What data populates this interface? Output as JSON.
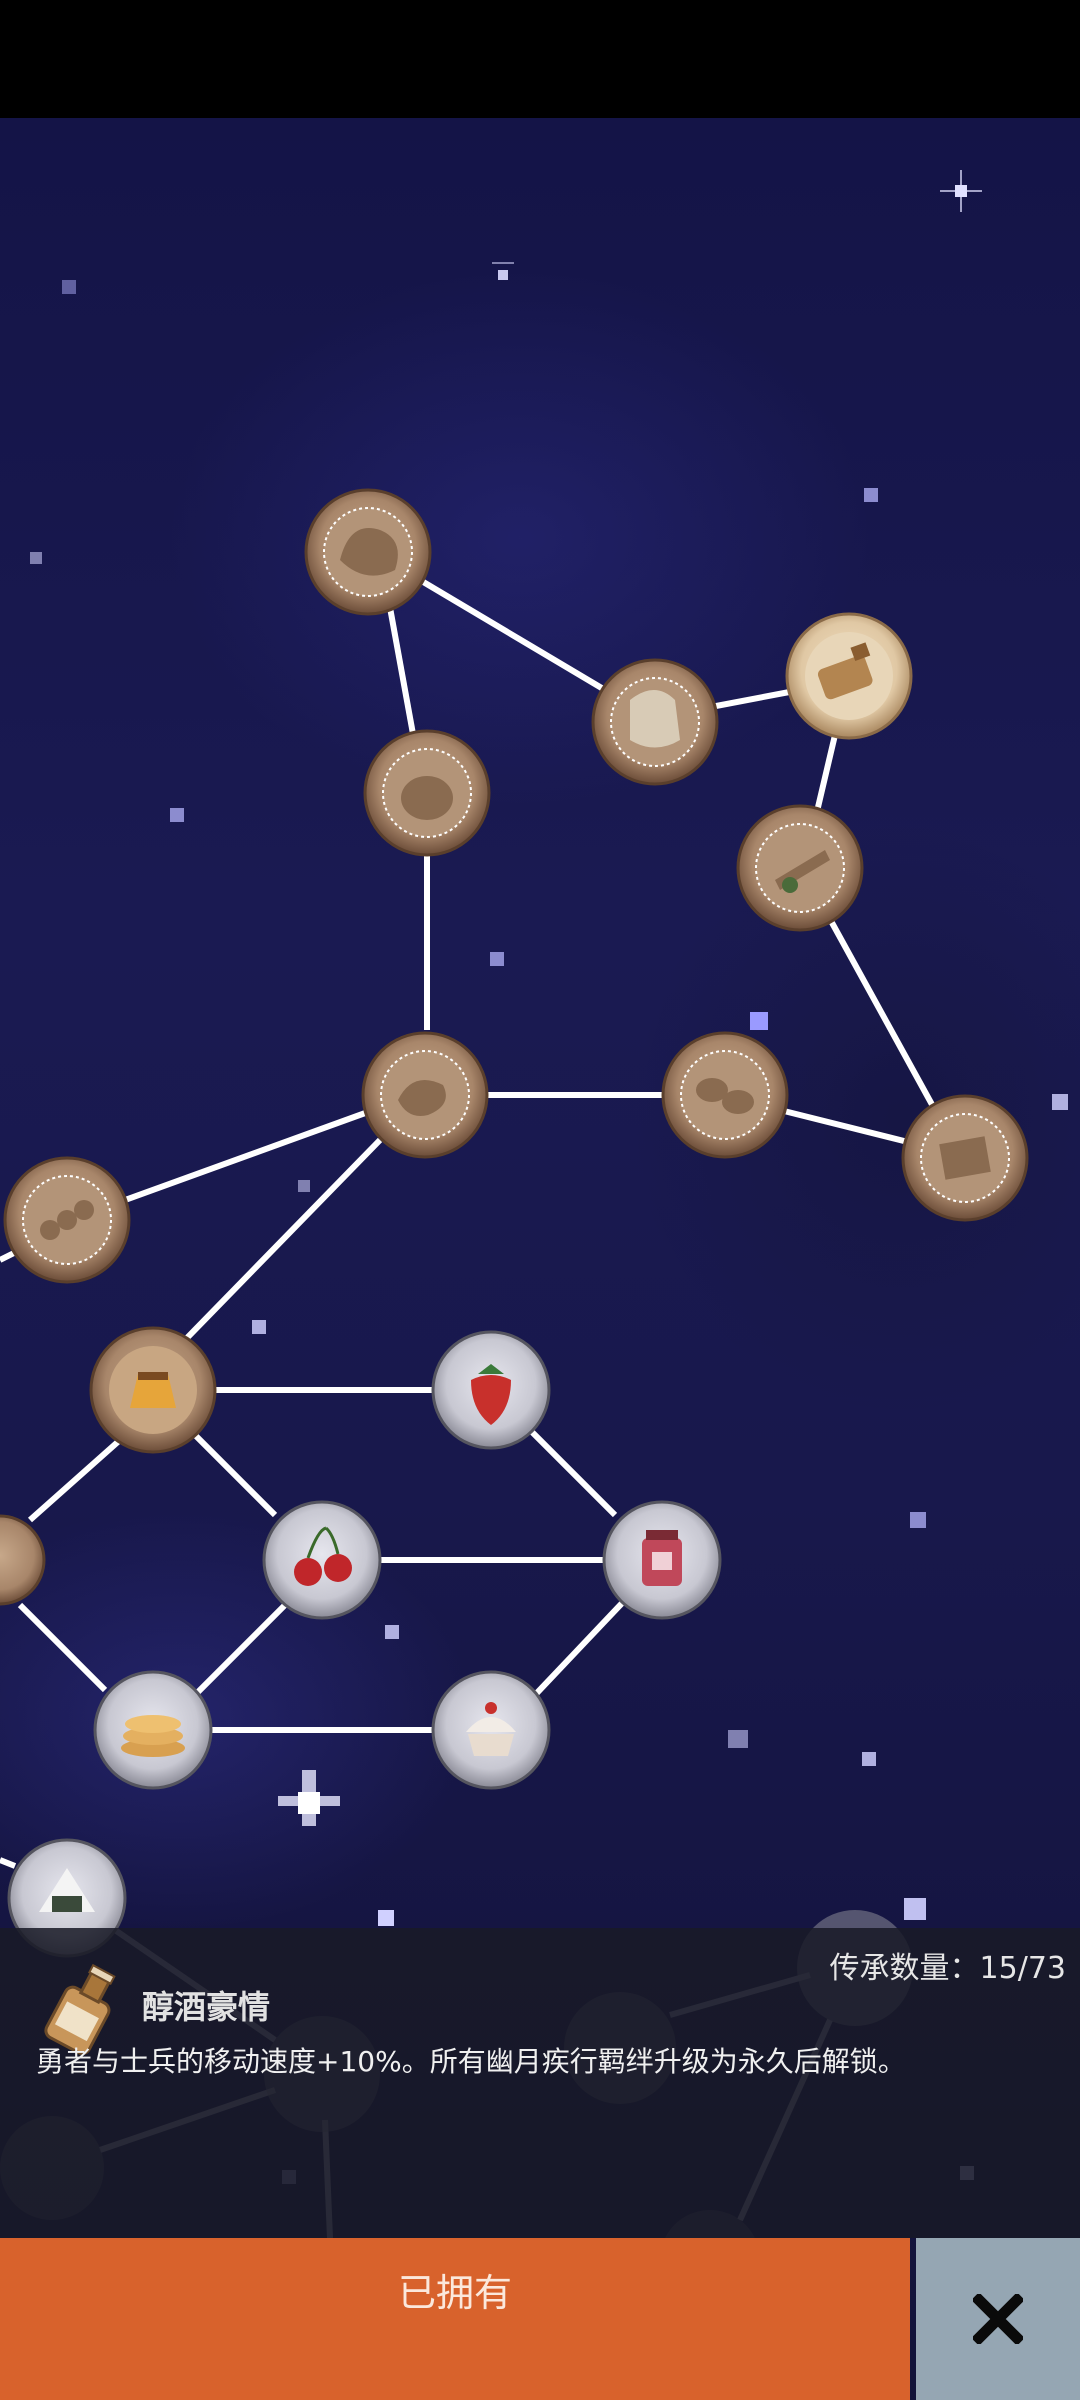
{
  "legacy": {
    "label": "传承数量：",
    "current": "15/73"
  },
  "selected_item": {
    "name": "醇酒豪情",
    "description": "勇者与士兵的移动速度+10%。所有幽月疾行羁绊升级为永久后解锁。",
    "icon": "liquor-bottle-icon"
  },
  "actions": {
    "owned_label": "已拥有",
    "close_icon": "close-x-icon"
  },
  "nodes": [
    {
      "id": "mushroom-bundle",
      "icon": "mushroom-icon",
      "state": "locked"
    },
    {
      "id": "potato-sack",
      "icon": "sack-icon",
      "state": "locked"
    },
    {
      "id": "liquor-bottle",
      "icon": "bottle-icon",
      "state": "selected"
    },
    {
      "id": "potato",
      "icon": "potato-icon",
      "state": "locked"
    },
    {
      "id": "ginseng-root",
      "icon": "root-icon",
      "state": "locked"
    },
    {
      "id": "roast-meat",
      "icon": "meat-icon",
      "state": "locked"
    },
    {
      "id": "cookies",
      "icon": "cookies-icon",
      "state": "locked"
    },
    {
      "id": "bread-loaf",
      "icon": "bread-icon",
      "state": "locked"
    },
    {
      "id": "skewer",
      "icon": "skewer-icon",
      "state": "locked"
    },
    {
      "id": "pudding",
      "icon": "pudding-icon",
      "state": "locked"
    },
    {
      "id": "strawberry",
      "icon": "strawberry-icon",
      "state": "unlocked"
    },
    {
      "id": "cherries",
      "icon": "cherries-icon",
      "state": "unlocked"
    },
    {
      "id": "jam-jar",
      "icon": "jam-jar-icon",
      "state": "unlocked"
    },
    {
      "id": "pancakes",
      "icon": "pancakes-icon",
      "state": "unlocked"
    },
    {
      "id": "cupcake",
      "icon": "cupcake-icon",
      "state": "unlocked"
    },
    {
      "id": "rice-ball",
      "icon": "rice-ball-icon",
      "state": "unlocked"
    },
    {
      "id": "left-edge-node",
      "icon": "herb-icon",
      "state": "locked"
    }
  ]
}
